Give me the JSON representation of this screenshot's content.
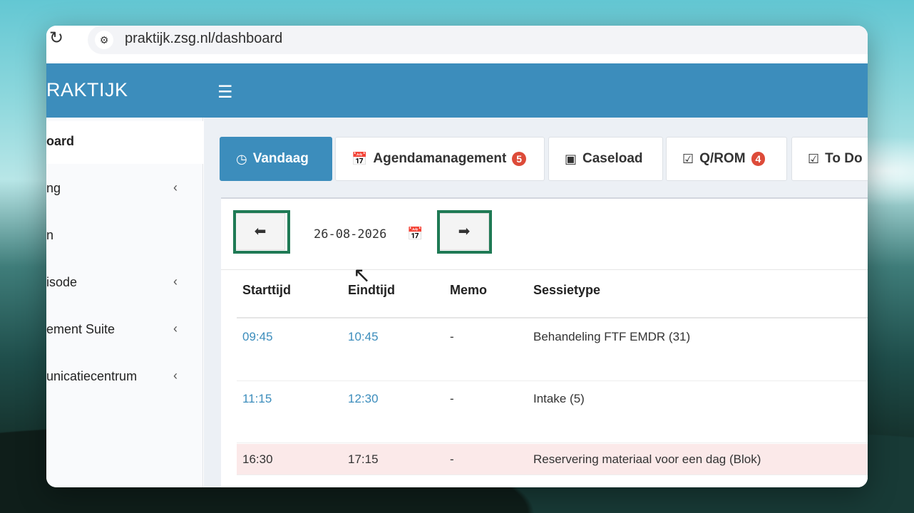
{
  "browser": {
    "url": "praktijk.zsg.nl/dashboard"
  },
  "app": {
    "logo": "RAKTIJK",
    "menu_icon": "hamburger-icon"
  },
  "sidebar": {
    "items": [
      {
        "label": "oard",
        "has_chevron": false,
        "active": true
      },
      {
        "label": "ng",
        "has_chevron": true
      },
      {
        "label": "n",
        "has_chevron": false
      },
      {
        "label": "isode",
        "has_chevron": true
      },
      {
        "label": "ement Suite",
        "has_chevron": true
      },
      {
        "label": "unicatiecentrum",
        "has_chevron": true
      }
    ]
  },
  "tabs": [
    {
      "label": "Vandaag",
      "icon": "clock-icon",
      "active": true
    },
    {
      "label": "Agendamanagement",
      "icon": "calendar-icon",
      "badge": "5"
    },
    {
      "label": "Caseload",
      "icon": "caseload-icon"
    },
    {
      "label": "Q/ROM",
      "icon": "checkbox-icon",
      "badge": "4"
    },
    {
      "label": "To Do",
      "icon": "checkbox-icon"
    }
  ],
  "datebar": {
    "date_value": "26-08-2026",
    "prev_icon": "arrow-left-circle-icon",
    "next_icon": "arrow-right-circle-icon"
  },
  "table": {
    "headers": [
      "Starttijd",
      "Eindtijd",
      "Memo",
      "Sessietype"
    ],
    "rows": [
      {
        "start": "09:45",
        "end": "10:45",
        "memo": "-",
        "type": "Behandeling FTF EMDR (31)"
      },
      {
        "start": "11:15",
        "end": "12:30",
        "memo": "-",
        "type": "Intake (5)"
      },
      {
        "start": "16:30",
        "end": "17:15",
        "memo": "-",
        "type": "Reservering materiaal voor een dag (Blok)"
      }
    ]
  },
  "colors": {
    "primary": "#3c8dbc",
    "badge": "#dd4b39",
    "highlight": "#1f7a55",
    "reserved_row": "#fbe9e9"
  }
}
